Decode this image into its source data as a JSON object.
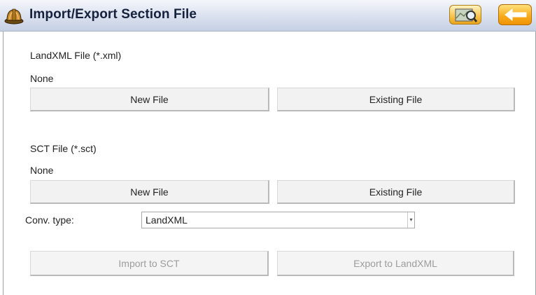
{
  "window": {
    "title": "Import/Export Section File",
    "icons": {
      "app": "hardhat-icon",
      "map": "map-magnifier-icon",
      "back": "back-arrow-icon"
    }
  },
  "landxml": {
    "label": "LandXML File (*.xml)",
    "value": "None",
    "new_button": "New File",
    "existing_button": "Existing File"
  },
  "sct": {
    "label": "SCT File (*.sct)",
    "value": "None",
    "new_button": "New File",
    "existing_button": "Existing File"
  },
  "conversion": {
    "label": "Conv. type:",
    "selected": "LandXML"
  },
  "actions": {
    "import_label": "Import to SCT",
    "export_label": "Export to LandXML"
  },
  "colors": {
    "title_text": "#14203c",
    "accent_orange": "#f7a91a",
    "disabled_text": "#9c9c9c"
  }
}
